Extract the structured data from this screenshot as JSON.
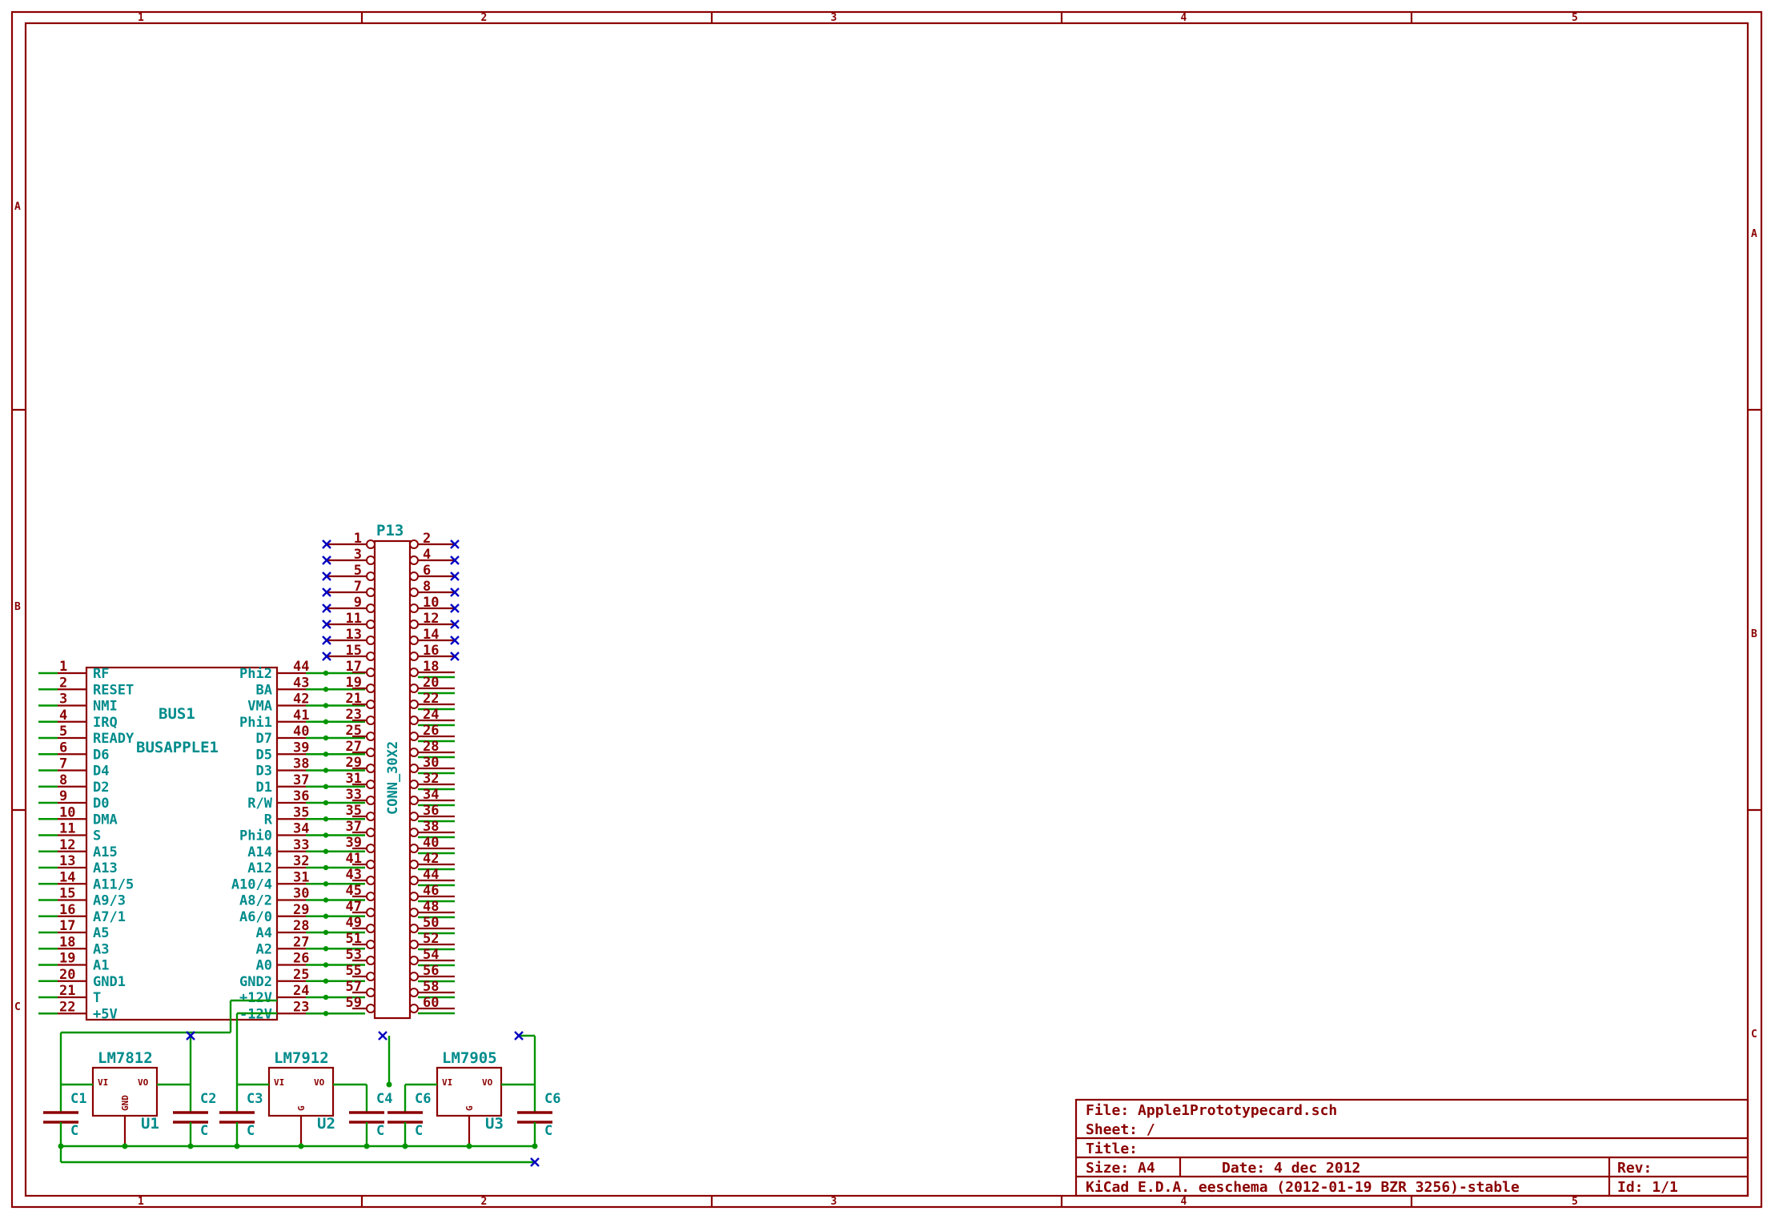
{
  "frame": {
    "column_labels": [
      "1",
      "2",
      "3",
      "4",
      "5"
    ],
    "row_labels": [
      "A",
      "B",
      "C"
    ]
  },
  "title_block": {
    "file": "File: Apple1Prototypecard.sch",
    "sheet": "Sheet: /",
    "title": "Title:",
    "size": "Size: A4",
    "date": "Date: 4 dec 2012",
    "rev": "Rev:",
    "kicad": "KiCad E.D.A.  eeschema (2012-01-19 BZR 3256)-stable",
    "id": "Id: 1/1"
  },
  "bus1": {
    "ref": "BUS1",
    "value": "BUSAPPLE1",
    "left_pins": [
      {
        "num": "1",
        "name": "RF"
      },
      {
        "num": "2",
        "name": "RESET"
      },
      {
        "num": "3",
        "name": "NMI"
      },
      {
        "num": "4",
        "name": "IRQ"
      },
      {
        "num": "5",
        "name": "READY"
      },
      {
        "num": "6",
        "name": "D6"
      },
      {
        "num": "7",
        "name": "D4"
      },
      {
        "num": "8",
        "name": "D2"
      },
      {
        "num": "9",
        "name": "D0"
      },
      {
        "num": "10",
        "name": "DMA"
      },
      {
        "num": "11",
        "name": "S"
      },
      {
        "num": "12",
        "name": "A15"
      },
      {
        "num": "13",
        "name": "A13"
      },
      {
        "num": "14",
        "name": "A11/5"
      },
      {
        "num": "15",
        "name": "A9/3"
      },
      {
        "num": "16",
        "name": "A7/1"
      },
      {
        "num": "17",
        "name": "A5"
      },
      {
        "num": "18",
        "name": "A3"
      },
      {
        "num": "19",
        "name": "A1"
      },
      {
        "num": "20",
        "name": "GND1"
      },
      {
        "num": "21",
        "name": "T"
      },
      {
        "num": "22",
        "name": "+5V"
      }
    ],
    "right_pins": [
      {
        "num": "44",
        "name": "Phi2"
      },
      {
        "num": "43",
        "name": "BA"
      },
      {
        "num": "42",
        "name": "VMA"
      },
      {
        "num": "41",
        "name": "Phi1"
      },
      {
        "num": "40",
        "name": "D7"
      },
      {
        "num": "39",
        "name": "D5"
      },
      {
        "num": "38",
        "name": "D3"
      },
      {
        "num": "37",
        "name": "D1"
      },
      {
        "num": "36",
        "name": "R/W"
      },
      {
        "num": "35",
        "name": "R"
      },
      {
        "num": "34",
        "name": "Phi0"
      },
      {
        "num": "33",
        "name": "A14"
      },
      {
        "num": "32",
        "name": "A12"
      },
      {
        "num": "31",
        "name": "A10/4"
      },
      {
        "num": "30",
        "name": "A8/2"
      },
      {
        "num": "29",
        "name": "A6/0"
      },
      {
        "num": "28",
        "name": "A4"
      },
      {
        "num": "27",
        "name": "A2"
      },
      {
        "num": "26",
        "name": "A0"
      },
      {
        "num": "25",
        "name": "GND2"
      },
      {
        "num": "24",
        "name": "+12V"
      },
      {
        "num": "23",
        "name": "-12V"
      }
    ]
  },
  "p13": {
    "ref": "P13",
    "value": "CONN_30X2",
    "left_pins": [
      "1",
      "3",
      "5",
      "7",
      "9",
      "11",
      "13",
      "15",
      "17",
      "19",
      "21",
      "23",
      "25",
      "27",
      "29",
      "31",
      "33",
      "35",
      "37",
      "39",
      "41",
      "43",
      "45",
      "47",
      "49",
      "51",
      "53",
      "55",
      "57",
      "59"
    ],
    "right_pins": [
      "2",
      "4",
      "6",
      "8",
      "10",
      "12",
      "14",
      "16",
      "18",
      "20",
      "22",
      "24",
      "26",
      "28",
      "30",
      "32",
      "34",
      "36",
      "38",
      "40",
      "42",
      "44",
      "46",
      "48",
      "50",
      "52",
      "54",
      "56",
      "58",
      "60"
    ]
  },
  "regulators": [
    {
      "value": "LM7812",
      "ref": "U1",
      "vi": "VI",
      "vo": "VO",
      "gnd": "GND"
    },
    {
      "value": "LM7912",
      "ref": "U2",
      "vi": "VI",
      "vo": "VO",
      "gnd": "G"
    },
    {
      "value": "LM7905",
      "ref": "U3",
      "vi": "VI",
      "vo": "VO",
      "gnd": "G"
    }
  ],
  "capacitors": [
    {
      "ref": "C1",
      "value": "C"
    },
    {
      "ref": "C2",
      "value": "C"
    },
    {
      "ref": "C3",
      "value": "C"
    },
    {
      "ref": "C4",
      "value": "C"
    },
    {
      "ref": "C6",
      "value": "C"
    },
    {
      "ref": "C6",
      "value": "C"
    }
  ],
  "colors": {
    "frame": "#8b0000",
    "wire": "#009400",
    "label": "#008b8b",
    "no_connect": "#0000c0"
  }
}
